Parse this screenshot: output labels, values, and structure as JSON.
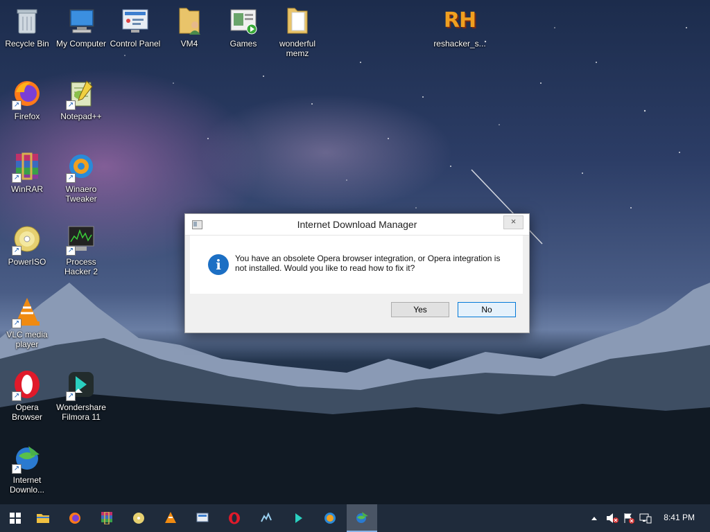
{
  "desktop": {
    "icons": [
      {
        "label": "Recycle Bin",
        "icon": "recycle-bin-icon"
      },
      {
        "label": "My Computer",
        "icon": "computer-icon"
      },
      {
        "label": "Control Panel",
        "icon": "control-panel-icon"
      },
      {
        "label": "VM4",
        "icon": "user-folder-icon"
      },
      {
        "label": "Games",
        "icon": "games-icon"
      },
      {
        "label": "wonderful memz",
        "icon": "folder-icon"
      },
      {
        "label": "reshacker_s...",
        "icon": "reshacker-icon",
        "glyph": "RH"
      },
      {
        "label": "Firefox",
        "icon": "firefox-icon"
      },
      {
        "label": "Notepad++",
        "icon": "notepad-plus-plus-icon"
      },
      {
        "label": "WinRAR",
        "icon": "winrar-icon"
      },
      {
        "label": "Winaero Tweaker",
        "icon": "winaero-tweaker-icon"
      },
      {
        "label": "PowerISO",
        "icon": "poweriso-icon"
      },
      {
        "label": "Process Hacker 2",
        "icon": "process-hacker-icon"
      },
      {
        "label": "VLC media player",
        "icon": "vlc-icon"
      },
      {
        "label": "Opera Browser",
        "icon": "opera-icon"
      },
      {
        "label": "Wondershare Filmora 11",
        "icon": "filmora-icon"
      },
      {
        "label": "Internet Downlo...",
        "icon": "internet-download-manager-icon"
      }
    ]
  },
  "dialog": {
    "title": "Internet Download Manager",
    "close_glyph": "×",
    "info_glyph": "i",
    "message": "You have an obsolete Opera browser integration, or Opera integration is not installed. Would you like to read how to fix it?",
    "yes_label": "Yes",
    "no_label": "No"
  },
  "taskbar": {
    "items": [
      "start-icon",
      "file-explorer-icon",
      "firefox-icon",
      "winrar-icon",
      "poweriso-icon",
      "vlc-icon",
      "control-panel-icon",
      "opera-icon",
      "process-hacker-icon",
      "filmora-icon",
      "winaero-tweaker-icon",
      "internet-download-manager-icon"
    ],
    "active_item": "internet-download-manager-icon",
    "clock": "8:41 PM"
  },
  "colors": {
    "taskbar": "#1f2b3b",
    "dialog_accent": "#0078d7",
    "info_icon": "#1c6fc4"
  }
}
